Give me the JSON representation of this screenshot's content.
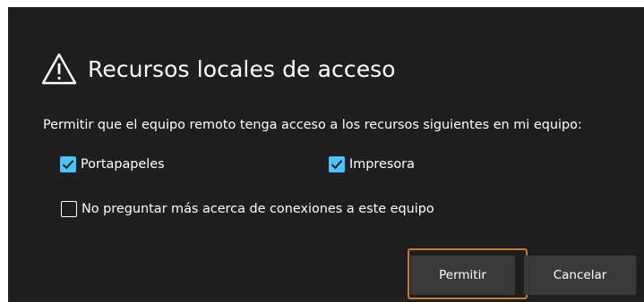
{
  "dialog": {
    "title": "Recursos locales de acceso",
    "title_icon": "warning-triangle-icon",
    "description": "Permitir que el equipo remoto tenga acceso a los recursos siguientes en mi equipo:",
    "options": {
      "clipboard": {
        "label": "Portapapeles",
        "checked": true
      },
      "printer": {
        "label": "Impresora",
        "checked": true
      },
      "dont_ask": {
        "label": "No preguntar más acerca de conexiones a este equipo",
        "checked": false
      }
    },
    "buttons": {
      "allow": "Permitir",
      "cancel": "Cancelar"
    }
  },
  "colors": {
    "background": "#1f1f1f",
    "checkbox_accent": "#4cc2ff",
    "highlight": "#c97a32",
    "button": "#3a3a3a",
    "text": "#ffffff"
  }
}
